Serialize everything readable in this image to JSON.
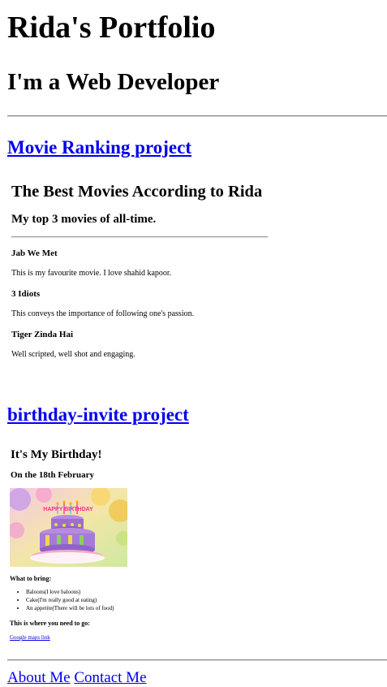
{
  "page": {
    "title": "Rida's Portfolio",
    "subtitle": "I'm a Web Developer"
  },
  "projects": [
    {
      "link_label": "Movie Ranking project"
    },
    {
      "link_label": "birthday-invite project"
    }
  ],
  "movie_ranking": {
    "title": "The Best Movies According to Rida",
    "subtitle": "My top 3 movies of all-time.",
    "movies": [
      {
        "name": "Jab We Met",
        "description": "This is my favourite movie. I love shahid kapoor."
      },
      {
        "name": "3 Idiots",
        "description": "This conveys the importance of following one's passion."
      },
      {
        "name": "Tiger Zinda Hai",
        "description": "Well scripted, well shot and engaging."
      }
    ]
  },
  "birthday_invite": {
    "title": "It's My Birthday!",
    "date_line": "On the 18th February",
    "image_text": "HAPPY BIRTHDAY",
    "bring_heading": "What to bring:",
    "bring_items": [
      "Baloons(I love baloons)",
      "Cake(I'm really good at eating)",
      "An appetite(There will be lots of food)"
    ],
    "where_heading": "This is where you need to go:",
    "map_link": "Google maps link"
  },
  "footer": {
    "about_label": "About Me",
    "contact_label": "Contact Me"
  },
  "colors": {
    "link": "#0000ee",
    "text": "#000000",
    "background": "#ffffff"
  }
}
